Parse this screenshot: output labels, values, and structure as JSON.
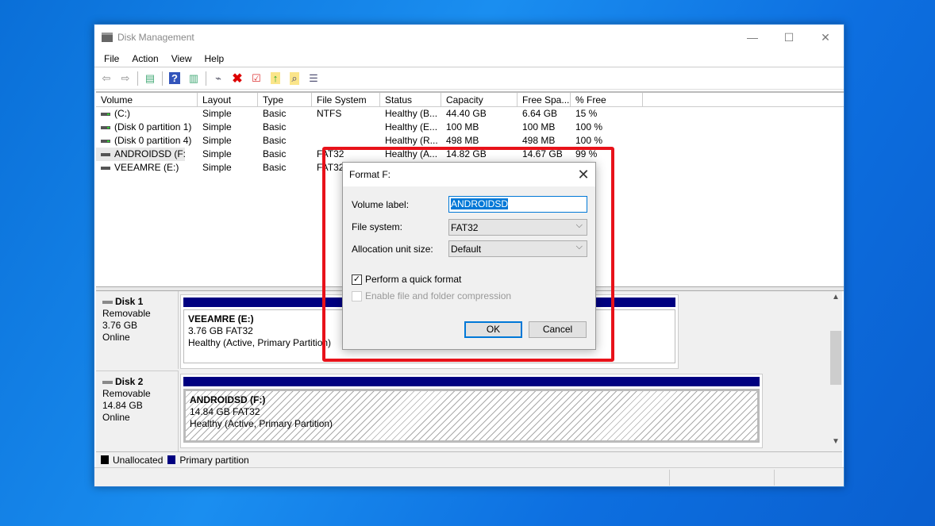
{
  "window": {
    "title": "Disk Management",
    "minimize": "—",
    "maximize": "☐",
    "close": "✕"
  },
  "menu": [
    "File",
    "Action",
    "View",
    "Help"
  ],
  "toolbar": [
    "back-icon",
    "forward-icon",
    "console-tree-icon",
    "help-icon",
    "action-pane-icon",
    "connect-disk-icon",
    "delete-icon",
    "properties-icon",
    "export-icon",
    "find-icon",
    "settings-icon"
  ],
  "columns": [
    "Volume",
    "Layout",
    "Type",
    "File System",
    "Status",
    "Capacity",
    "Free Spa...",
    "% Free"
  ],
  "volumes": [
    [
      "(C:)",
      "Simple",
      "Basic",
      "NTFS",
      "Healthy (B...",
      "44.40 GB",
      "6.64 GB",
      "15 %"
    ],
    [
      "(Disk 0 partition 1)",
      "Simple",
      "Basic",
      "",
      "Healthy (E...",
      "100 MB",
      "100 MB",
      "100 %"
    ],
    [
      "(Disk 0 partition 4)",
      "Simple",
      "Basic",
      "",
      "Healthy (R...",
      "498 MB",
      "498 MB",
      "100 %"
    ],
    [
      "ANDROIDSD (F:)",
      "Simple",
      "Basic",
      "FAT32",
      "Healthy (A...",
      "14.82 GB",
      "14.67 GB",
      "99 %"
    ],
    [
      "VEEAMRE (E:)",
      "Simple",
      "Basic",
      "FAT32",
      "",
      "",
      "",
      ""
    ]
  ],
  "disks": [
    {
      "name": "Disk 1",
      "type": "Removable",
      "size": "3.76 GB",
      "state": "Online",
      "part_name": "VEEAMRE  (E:)",
      "part_size": "3.76 GB FAT32",
      "part_status": "Healthy (Active, Primary Partition)"
    },
    {
      "name": "Disk 2",
      "type": "Removable",
      "size": "14.84 GB",
      "state": "Online",
      "part_name": "ANDROIDSD  (F:)",
      "part_size": "14.84 GB FAT32",
      "part_status": "Healthy (Active, Primary Partition)"
    }
  ],
  "legend": {
    "unallocated": "Unallocated",
    "primary": "Primary partition",
    "unallocated_color": "#000000",
    "primary_color": "#000080"
  },
  "dialog": {
    "title": "Format F:",
    "close": "✕",
    "volume_label_text": "Volume label:",
    "volume_label_value": "ANDROIDSD",
    "fs_text": "File system:",
    "fs_value": "FAT32",
    "alloc_text": "Allocation unit size:",
    "alloc_value": "Default",
    "quick_format": "Perform a quick format",
    "quick_checked": "✓",
    "compression": "Enable file and folder compression",
    "ok": "OK",
    "cancel": "Cancel",
    "chevron": "⌵"
  }
}
